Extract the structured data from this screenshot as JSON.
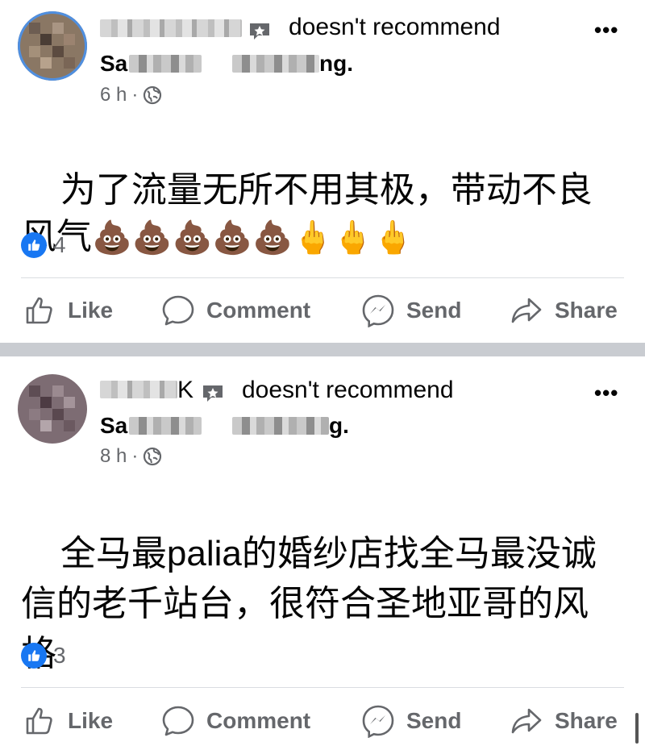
{
  "posts": [
    {
      "author_suffix": "",
      "recommendation": "doesn't recommend",
      "page_prefix": "Sa",
      "page_suffix": "ng.",
      "time": "6 h",
      "text": "为了流量无所不用其极，带动不良风气",
      "emojis": "💩💩💩💩💩🖕🖕🖕",
      "like_count": "4"
    },
    {
      "author_suffix": "K",
      "recommendation": "doesn't recommend",
      "page_prefix": "Sa",
      "page_suffix": "g.",
      "time": "8 h",
      "text": "全马最palia的婚纱店找全马最没诚信的老千站台，很符合圣地亚哥的风格",
      "emojis": "",
      "like_count": "3"
    }
  ],
  "actions": {
    "like": "Like",
    "comment": "Comment",
    "send": "Send",
    "share": "Share"
  },
  "icons": {
    "recommend": "star-badge-icon",
    "audience": "globe-icon",
    "more": "more-options-icon",
    "reaction": "thumbs-up-icon"
  },
  "colors": {
    "accent": "#1877f2",
    "secondary_text": "#65676b",
    "separator": "#c9ccd1"
  }
}
